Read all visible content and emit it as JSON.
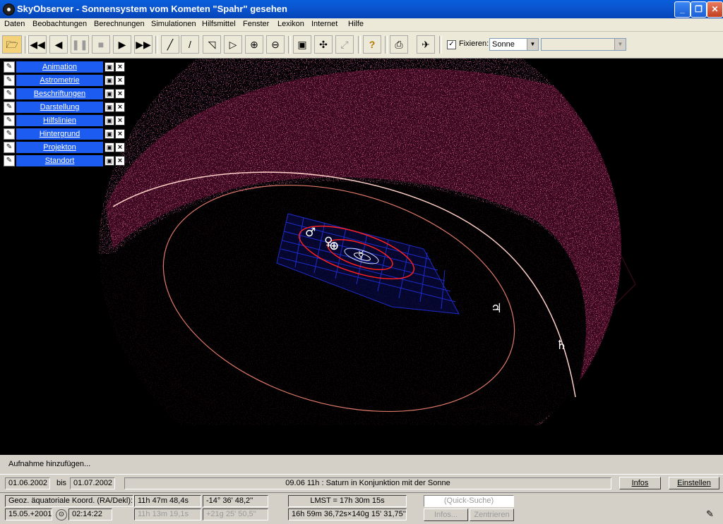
{
  "window": {
    "title": "SkyObserver - Sonnensystem vom Kometen \"Spahr\" gesehen"
  },
  "menu": [
    "Daten",
    "Beobachtungen",
    "Berechnungen",
    "Simulationen",
    "Hilfsmittel",
    "Fenster",
    "Lexikon",
    "Internet",
    "Hilfe"
  ],
  "toolbar": {
    "fix_label": "Fixieren:",
    "fix_checked": "✓",
    "fix_value": "Sonne",
    "second_combo": ""
  },
  "panels": [
    "Animation",
    "Astrometrie",
    "Beschriftungen",
    "Darstellung",
    "Hilfslinien",
    "Hintergrund",
    "Projekton",
    "Standort"
  ],
  "planets": {
    "mars": "♂",
    "venus": "♀",
    "earth": "⊕",
    "mercury": "☿",
    "jupiter": "♃",
    "saturn": "♄"
  },
  "colors": {
    "milky_way": "#b0205a",
    "orbit_red": "#ff2020",
    "grid_blue": "#1e2ccc",
    "constellation": "#4a0d22",
    "panel_blue": "#1d5cf0",
    "titlebar": "#0b55d0"
  },
  "hint": {
    "text": "Aufnahme hinzufügen..."
  },
  "datebar": {
    "start_date": "01.06.2002",
    "bis": "bis",
    "end_date": "01.07.2002",
    "event": "09.06  11h :  Saturn in Konjunktion mit der Sonne",
    "infos_button": "Infos",
    "einstellen_button": "Einstellen"
  },
  "status": {
    "coord_label": "Geoz. äquatoriale Koord. (RA/Dekl):",
    "ra": "11h 47m 48,4s",
    "dec": "-14° 36' 48,2''",
    "ra2": "11h 13m 19,1s",
    "dec2": "+21g 25' 50,5''",
    "lmst": "LMST = 17h 30m 15s",
    "lmst2": "16h 59m 36,72s×140g 15' 31,75''",
    "date": "15.05.+2001",
    "time": "02:14:22",
    "quick_search_placeholder": "(Quick-Suche)",
    "infos_button": "Infos...",
    "zentrieren_button": "Zentrieren"
  }
}
